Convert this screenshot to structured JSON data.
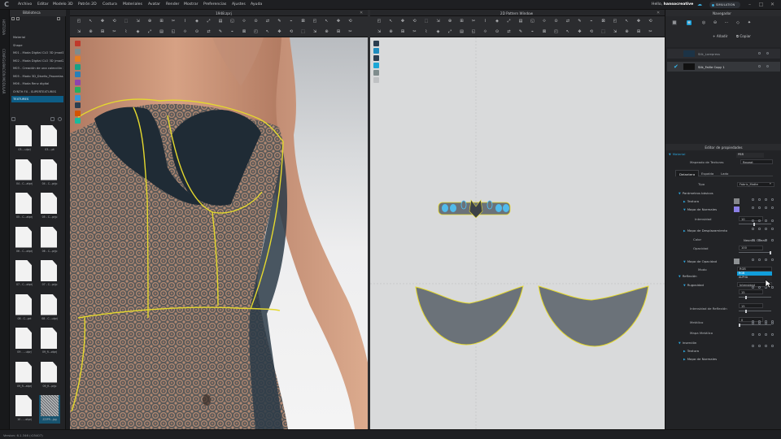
{
  "menu": {
    "items": [
      "Archivo",
      "Editar",
      "Modelo 3D",
      "Patrón 2D",
      "Costura",
      "Materiales",
      "Avatar",
      "Render",
      "Mostrar",
      "Preferencias",
      "Ajustes",
      "Ayuda"
    ],
    "user_hello": "Hello,",
    "user_name": "hansocreative",
    "simulation": "SIMULATION"
  },
  "vertical_tabs": [
    "HISTORIA",
    "CONFIGURACIÓN MODULAR"
  ],
  "library": {
    "title": "Biblioteca",
    "tree": [
      {
        "label": "Material",
        "selected": false
      },
      {
        "label": "Shape",
        "selected": false
      },
      {
        "label": "M01 - Moda Digital CLO 3D (mod1)",
        "selected": false
      },
      {
        "label": "M02 - Moda Digital CLO 3D (mod2)",
        "selected": false
      },
      {
        "label": "M03 - Creación de una colección 3D",
        "selected": false
      },
      {
        "label": "M05 - Modo 3D_Diseño_Pasarelas 3D",
        "selected": false
      },
      {
        "label": "M06 - Moda Renz digital",
        "selected": false
      },
      {
        "label": "SYNTH FX - SUPERTEXTURES",
        "selected": false
      },
      {
        "label": "TEXTURES",
        "selected": true
      }
    ],
    "thumbnails": [
      {
        "caption": "03-...ulprj",
        "kind": "doc",
        "selected": false
      },
      {
        "caption": "03-...pt",
        "kind": "doc",
        "selected": false
      },
      {
        "caption": "04 - C...atprj",
        "kind": "doc",
        "selected": false
      },
      {
        "caption": "04 - C...prjp",
        "kind": "doc",
        "selected": false
      },
      {
        "caption": "05 - C...atprj",
        "kind": "doc",
        "selected": false
      },
      {
        "caption": "05 - C...prjp",
        "kind": "doc",
        "selected": false
      },
      {
        "caption": "06 - C...otprj",
        "kind": "doc",
        "selected": false
      },
      {
        "caption": "06 - C...prjp",
        "kind": "doc",
        "selected": false
      },
      {
        "caption": "07 - C...otprj",
        "kind": "doc",
        "selected": false
      },
      {
        "caption": "07 - C...prjp",
        "kind": "doc",
        "selected": false
      },
      {
        "caption": "08 - C...prt",
        "kind": "doc",
        "selected": false
      },
      {
        "caption": "08 - C...ulprj",
        "kind": "doc",
        "selected": false
      },
      {
        "caption": "09 - ...ulprj",
        "kind": "doc",
        "selected": false
      },
      {
        "caption": "09_fi...otprj",
        "kind": "doc",
        "selected": false
      },
      {
        "caption": "09_fi...atprj",
        "kind": "doc",
        "selected": false
      },
      {
        "caption": "09_fi...prjp",
        "kind": "doc",
        "selected": false
      },
      {
        "caption": "10 - ...otprj",
        "kind": "doc",
        "selected": false
      },
      {
        "caption": "ZZIPR...jpg",
        "kind": "lace",
        "selected": true
      }
    ]
  },
  "viewport3d": {
    "title": "1948.zprj"
  },
  "viewport2d": {
    "title": "2D Pattern Window"
  },
  "object_browser": {
    "title": "Navegador",
    "add_label": "+ Añadir",
    "copy_label": "⧉ Copiar",
    "rows": [
      {
        "name": "Silk_Lorepress",
        "selected": false
      },
      {
        "name": "Silk_Faille Copy 1",
        "selected": true
      }
    ]
  },
  "properties": {
    "title": "Editor de propiedades",
    "section_material": "Material",
    "material_type": "PBR",
    "texture_mapping_label": "Mapeado de Texturas",
    "texture_mapping_value": "Repeat",
    "tabs": [
      "Delantera",
      "Espalda",
      "Lado"
    ],
    "tipo_label": "Tipo",
    "tipo_value": "Fabric_Matte",
    "basic_params": "Parámetros básicos",
    "textura": "Textura",
    "normal_map": "Mapa de Normales",
    "intensidad_label": "Intensidad",
    "intensidad_value": "10",
    "displacement_map": "Mapa de Desplazamiento",
    "color_label": "Color",
    "color_value": "Neon01 Ocean",
    "opacidad_label": "Opacidad",
    "opacidad_value": "100",
    "opacity_map": "Mapa de Opacidad",
    "modo_label": "Modo",
    "modo_value": "RGB",
    "modo_options": [
      "RGB",
      "ALPHA"
    ],
    "reflexion": "Reflexión",
    "rugosidad": "Rugosidad",
    "rugosidad_mode": "Intensidad",
    "rugosidad_value": "15",
    "reflex_intensity_label": "Intensidad de Reflexión",
    "reflex_intensity_value": "15",
    "metalico_label": "Metálico",
    "metalico_value": "0",
    "mapa_metalico": "Mapa Metálico",
    "insercion": "Inserción",
    "ins_textura": "Textura",
    "ins_normal": "Mapa de Normales"
  },
  "status": {
    "text": "Version: 6.1.346 (r25407)"
  },
  "colors": {
    "accent": "#119edb",
    "trim": "#e5d92e",
    "pattern_piece": "#6b7279",
    "selection_bg": "#0d5d86"
  }
}
